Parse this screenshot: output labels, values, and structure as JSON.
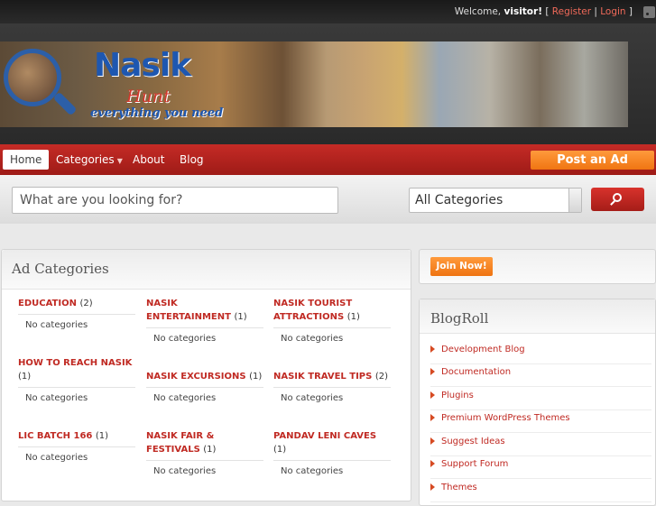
{
  "topbar": {
    "welcome_prefix": "Welcome,",
    "user": "visitor!",
    "register": "Register",
    "login": "Login"
  },
  "logo": {
    "name": "Nasik",
    "sub": "Hunt",
    "tagline": "everything you need"
  },
  "nav": {
    "home": "Home",
    "categories": "Categories",
    "about": "About",
    "blog": "Blog",
    "post_ad": "Post an Ad"
  },
  "search": {
    "placeholder": "What are you looking for?",
    "category": "All Categories"
  },
  "ad_categories": {
    "title": "Ad Categories",
    "items": [
      {
        "name": "EDUCATION",
        "count": "(2)",
        "empty": "No categories"
      },
      {
        "name": "NASIK ENTERTAINMENT",
        "count": "(1)",
        "empty": "No categories"
      },
      {
        "name": "NASIK TOURIST ATTRACTIONS",
        "count": "(1)",
        "empty": "No categories"
      },
      {
        "name": "HOW TO REACH NASIK",
        "count": "(1)",
        "empty": "No categories"
      },
      {
        "name": "NASIK EXCURSIONS",
        "count": "(1)",
        "empty": "No categories"
      },
      {
        "name": "NASIK TRAVEL TIPS",
        "count": "(2)",
        "empty": "No categories"
      },
      {
        "name": "LIC BATCH 166",
        "count": "(1)",
        "empty": "No categories"
      },
      {
        "name": "NASIK FAIR & FESTIVALS",
        "count": "(1)",
        "empty": "No categories"
      },
      {
        "name": "PANDAV LENI CAVES",
        "count": "(1)",
        "empty": "No categories"
      }
    ]
  },
  "join": {
    "label": "Join Now!"
  },
  "blogroll": {
    "title": "BlogRoll",
    "links": [
      "Development Blog",
      "Documentation",
      "Plugins",
      "Premium WordPress Themes",
      "Suggest Ideas",
      "Support Forum",
      "Themes"
    ]
  },
  "colors": {
    "brand_red": "#c02a23",
    "accent_orange": "#f07512",
    "logo_blue": "#1e57b0"
  }
}
